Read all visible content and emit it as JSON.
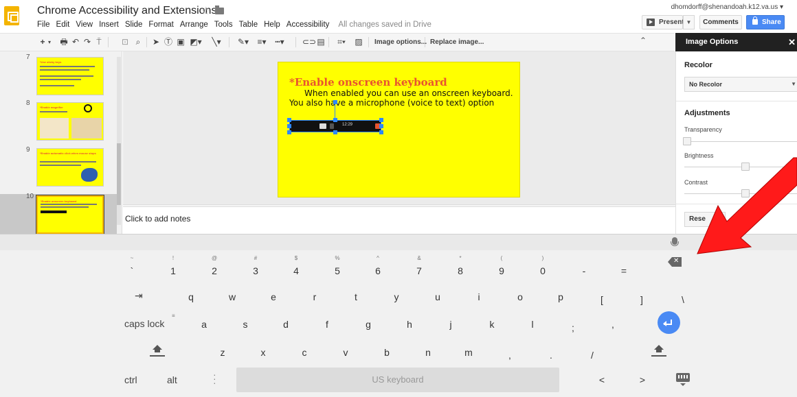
{
  "header": {
    "doc_title": "Chrome Accessibility  and Extensions",
    "user_email": "dhomdorff@shenandoah.k12.va.us ▾",
    "saved_status": "All changes saved in Drive",
    "present_label": "Present",
    "comments_label": "Comments",
    "share_label": "Share"
  },
  "menu": [
    "File",
    "Edit",
    "View",
    "Insert",
    "Slide",
    "Format",
    "Arrange",
    "Tools",
    "Table",
    "Help",
    "Accessibility"
  ],
  "toolbar": {
    "image_options_label": "Image options...",
    "replace_image_label": "Replace image..."
  },
  "panel": {
    "title": "Image Options",
    "recolor_heading": "Recolor",
    "recolor_value": "No Recolor",
    "adjustments_heading": "Adjustments",
    "transparency_label": "Transparency",
    "brightness_label": "Brightness",
    "contrast_label": "Contrast",
    "reset_label": "Rese",
    "transparency_value": 0,
    "brightness_value": 0.5,
    "contrast_value": 0.5
  },
  "filmstrip": {
    "slide_numbers": [
      "7",
      "8",
      "9",
      "10"
    ],
    "thumb_titles": [
      "*Use sticky keys",
      "*Enable magnifier",
      "*Enable automatic click when mouse stops",
      "*Enable onscreen keyboard"
    ]
  },
  "slide": {
    "title": "*Enable onscreen keyboard",
    "body": "When enabled you can use an onscreen keyboard.  You also have a microphone (voice to text) option",
    "image_time": "12:29"
  },
  "notes": {
    "placeholder": "Click to add notes"
  },
  "keyboard": {
    "number_row_sub": [
      "~",
      "!",
      "@",
      "#",
      "$",
      "%",
      "^",
      "&",
      "*",
      "(",
      ")"
    ],
    "number_row": [
      "`",
      "1",
      "2",
      "3",
      "4",
      "5",
      "6",
      "7",
      "8",
      "9",
      "0",
      "-",
      "="
    ],
    "row_q": [
      "q",
      "w",
      "e",
      "r",
      "t",
      "y",
      "u",
      "i",
      "o",
      "p",
      "[",
      "]",
      "\\"
    ],
    "row_a": [
      "a",
      "s",
      "d",
      "f",
      "g",
      "h",
      "j",
      "k",
      "l",
      ";",
      ","
    ],
    "row_z": [
      "z",
      "x",
      "c",
      "v",
      "b",
      "n",
      "m",
      ",",
      ".",
      "/"
    ],
    "caps_lock_label": "caps lock",
    "ctrl_label": "ctrl",
    "alt_label": "alt",
    "space_label": "US keyboard",
    "left_arrow": "<",
    "right_arrow": ">"
  },
  "colors": {
    "slide_bg": "#ffff00",
    "slide_title": "#e8542f",
    "accent_blue": "#4a8af4",
    "annotation_arrow": "#ff0000"
  }
}
